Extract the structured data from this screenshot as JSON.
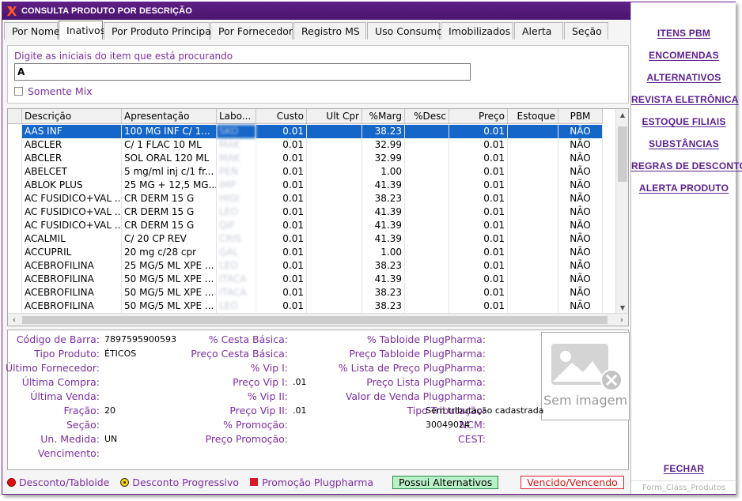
{
  "title": "CONSULTA PRODUTO POR DESCRIÇÃO",
  "tabs": [
    {
      "label": "Por Nome",
      "width": 68
    },
    {
      "label": "Inativos",
      "width": 56
    },
    {
      "label": "Por Produto Principal",
      "width": 134
    },
    {
      "label": "Por Fornecedor",
      "width": 104
    },
    {
      "label": "Registro MS",
      "width": 92
    },
    {
      "label": "Uso Consumo",
      "width": 92
    },
    {
      "label": "Imobilizados",
      "width": 92
    },
    {
      "label": "Alerta",
      "width": 62
    },
    {
      "label": "Seção",
      "width": 56
    }
  ],
  "search": {
    "label": "Digite as iniciais do item que está procurando",
    "value": "A",
    "mix_label": "Somente Mix"
  },
  "grid": {
    "columns": [
      "Descrição",
      "Apresentação",
      "Labo...",
      "Custo",
      "Ult Cpr",
      "%Marg",
      "%Desc",
      "Preço",
      "Estoque",
      "PBM"
    ],
    "rows": [
      [
        "AAS INF",
        "100 MG INF C/ 1...",
        "SKO",
        "0.01",
        "",
        "38.23",
        "",
        "0.01",
        "",
        "NÃO"
      ],
      [
        "ABCLER",
        "C/ 1 FLAC 10 ML",
        "MAK",
        "0.01",
        "",
        "32.99",
        "",
        "0.01",
        "",
        "NÃO"
      ],
      [
        "ABCLER",
        "SOL ORAL 120 ML",
        "MAK",
        "0.01",
        "",
        "32.99",
        "",
        "0.01",
        "",
        "NÃO"
      ],
      [
        "ABELCET",
        "5 mg/ml inj c/1 fr...",
        "PEN",
        "0.01",
        "",
        "1.00",
        "",
        "0.01",
        "",
        "NÃO"
      ],
      [
        "ABLOK PLUS",
        "25 MG + 12,5 MG...",
        "IMP",
        "0.01",
        "",
        "41.39",
        "",
        "0.01",
        "",
        "NÃO"
      ],
      [
        "AC FUSIDICO+VAL ...",
        "CR DERM 15 G",
        "HIGI",
        "0.01",
        "",
        "38.23",
        "",
        "0.01",
        "",
        "NÃO"
      ],
      [
        "AC FUSIDICO+VAL ...",
        "CR DERM 15 G",
        "LEO",
        "0.01",
        "",
        "41.39",
        "",
        "0.01",
        "",
        "NÃO"
      ],
      [
        "AC FUSIDICO+VAL ...",
        "CR DERM 15 G",
        "QIF",
        "0.01",
        "",
        "41.39",
        "",
        "0.01",
        "",
        "NÃO"
      ],
      [
        "ACALMIL",
        "C/ 20 CP REV",
        "CRIS",
        "0.01",
        "",
        "41.39",
        "",
        "0.01",
        "",
        "NÃO"
      ],
      [
        "ACCUPRIL",
        "20 mg c/28 cpr",
        "GAL",
        "0.01",
        "",
        "1.00",
        "",
        "0.01",
        "",
        "NÃO"
      ],
      [
        "ACEBROFILINA",
        "25 MG/5 ML XPE ...",
        "LEO",
        "0.01",
        "",
        "38.23",
        "",
        "0.01",
        "",
        "NÃO"
      ],
      [
        "ACEBROFILINA",
        "50 MG/5 ML XPE ...",
        "ITACA",
        "0.01",
        "",
        "41.39",
        "",
        "0.01",
        "",
        "NÃO"
      ],
      [
        "ACEBROFILINA",
        "50 MG/5 ML XPE ...",
        "ITACA",
        "0.01",
        "",
        "38.23",
        "",
        "0.01",
        "",
        "NÃO"
      ],
      [
        "ACEBROFILINA",
        "50 MG/5 ML XPE ...",
        "LEO",
        "0.01",
        "",
        "38.23",
        "",
        "0.01",
        "",
        "NÃO"
      ]
    ]
  },
  "details": {
    "col1": [
      {
        "label": "Código de Barra:",
        "value": "7897595900593"
      },
      {
        "label": "Tipo Produto:",
        "value": "ÉTICOS"
      },
      {
        "label": "Último Fornecedor:",
        "value": ""
      },
      {
        "label": "Última Compra:",
        "value": ""
      },
      {
        "label": "Última Venda:",
        "value": ""
      },
      {
        "label": "Fração:",
        "value": "20"
      },
      {
        "label": "Seção:",
        "value": ""
      },
      {
        "label": "Un. Medida:",
        "value": "UN"
      },
      {
        "label": "Vencimento:",
        "value": ""
      }
    ],
    "col2": [
      {
        "label": "% Cesta Básica:",
        "value": ""
      },
      {
        "label": "Preço Cesta Básica:",
        "value": ""
      },
      {
        "label": "% Vip I:",
        "value": ""
      },
      {
        "label": "Preço Vip I:",
        "value": ".01"
      },
      {
        "label": "% Vip II:",
        "value": ""
      },
      {
        "label": "Preço Vip II:",
        "value": ".01"
      },
      {
        "label": "% Promoção:",
        "value": ""
      },
      {
        "label": "Preço Promoção:",
        "value": ""
      }
    ],
    "col3": [
      {
        "label": "% Tabloide PlugPharma:",
        "value": ""
      },
      {
        "label": "Preço Tabloide PlugPharma:",
        "value": ""
      },
      {
        "label": "% Lista de Preço PlugPharma:",
        "value": ""
      },
      {
        "label": "Preço Lista PlugPharma:",
        "value": ""
      },
      {
        "label": "Valor de Venda Plugpharma:",
        "value": ""
      },
      {
        "label": "Tipo Tributação:",
        "value": "Sem tributação cadastrada"
      },
      {
        "label": "NCM:",
        "value": "30049024"
      },
      {
        "label": "CEST:",
        "value": ""
      }
    ],
    "image_label": "Sem imagem"
  },
  "legend": {
    "desconto_tabloide": "Desconto/Tabloide",
    "desconto_progressivo": "Desconto Progressivo",
    "promocao": "Promoção Plugpharma",
    "possui_alternativos": "Possui Alternativos",
    "vencido": "Vencido/Vencendo"
  },
  "sidebar": {
    "items": [
      {
        "label": "ITENS PBM",
        "name": "sidebar-itens-pbm"
      },
      {
        "label": "ENCOMENDAS",
        "name": "sidebar-encomendas"
      },
      {
        "label": "ALTERNATIVOS",
        "name": "sidebar-alternativos"
      },
      {
        "label": "REVISTA ELETRÔNICA",
        "name": "sidebar-revista-eletronica"
      },
      {
        "label": "ESTOQUE FILIAIS",
        "name": "sidebar-estoque-filiais"
      },
      {
        "label": "SUBSTÂNCIAS",
        "name": "sidebar-substancias"
      },
      {
        "label": "REGRAS DE DESCONTO",
        "name": "sidebar-regras-desconto"
      },
      {
        "label": "ALERTA PRODUTO",
        "name": "sidebar-alerta-produto"
      }
    ],
    "close_label": "FECHAR",
    "form_name": "Form_Class_Produtos"
  },
  "colors": {
    "title_bar": "#4a156e",
    "accent": "#7b2fa3",
    "selection": "#1466c8"
  }
}
